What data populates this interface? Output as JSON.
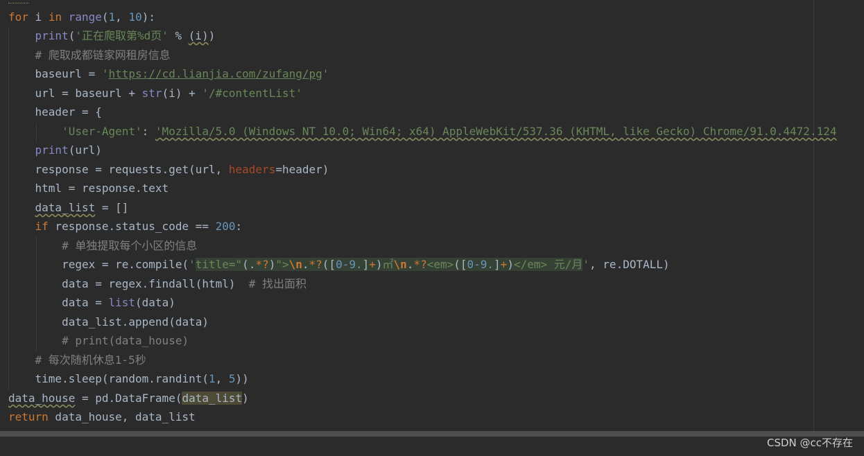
{
  "editor": {
    "lines": [
      "for i in range(1, 10):",
      "    print('正在爬取第%d页' % (i))",
      "    # 爬取成都链家网租房信息",
      "    baseurl = 'https://cd.lianjia.com/zufang/pg'",
      "    url = baseurl + str(i) + '/#contentList'",
      "    header = {",
      "        'User-Agent': 'Mozilla/5.0 (Windows NT 10.0; Win64; x64) AppleWebKit/537.36 (KHTML, like Gecko) Chrome/91.0.4472.124",
      "    print(url)",
      "    response = requests.get(url, headers=header)",
      "    html = response.text",
      "    data_list = []",
      "    if response.status_code == 200:",
      "        # 单独提取每个小区的信息",
      "        regex = re.compile('title=\"(.*?)\">\\n.*?([0-9.]+)㎡\\n.*?<em>([0-9.]+)</em> 元/月', re.DOTALL)",
      "        data = regex.findall(html)  # 找出面积",
      "        data = list(data)",
      "        data_list.append(data)",
      "        # print(data_house)",
      "    # 每次随机休息1-5秒",
      "    time.sleep(random.randint(1, 5))",
      "data_house = pd.DataFrame(data_list)",
      "return data_house, data_list"
    ]
  },
  "watermark": "CSDN @cc不存在"
}
